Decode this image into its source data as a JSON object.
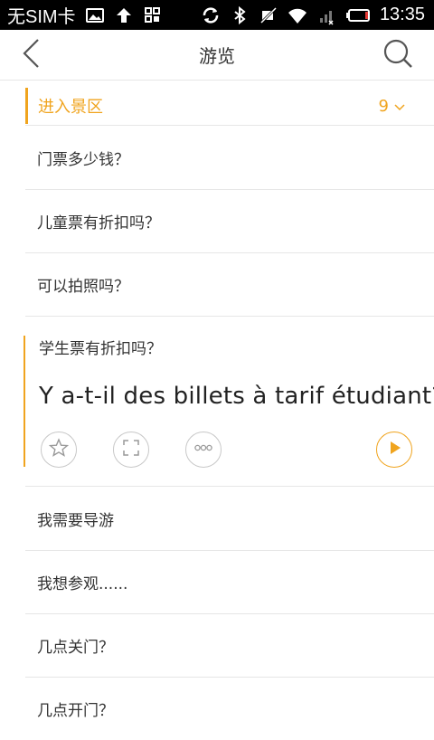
{
  "status_bar": {
    "carrier": "无SIM卡",
    "time": "13:35",
    "icons": [
      "image-icon",
      "upload-arrow-icon",
      "grid-icon",
      "sync-icon",
      "bluetooth-icon",
      "mute-icon",
      "wifi-icon",
      "signal-icon",
      "battery-icon"
    ]
  },
  "header": {
    "title": "游览",
    "back_icon": "chevron-left-icon",
    "search_icon": "search-icon"
  },
  "section": {
    "title": "进入景区",
    "count": "9",
    "accent_color": "#f0a41e"
  },
  "phrases": [
    {
      "question": "门票多少钱？"
    },
    {
      "question": "儿童票有折扣吗？"
    },
    {
      "question": "可以拍照吗？"
    },
    {
      "question": "学生票有折扣吗？",
      "translation": "Y a-t-il des billets à tarif étudiant?",
      "expanded": true
    },
    {
      "question": "我需要导游"
    },
    {
      "question": "我想参观......"
    },
    {
      "question": "几点关门？"
    },
    {
      "question": "几点开门？"
    }
  ],
  "actions": [
    "star-icon",
    "expand-icon",
    "more-icon",
    "play-icon"
  ]
}
